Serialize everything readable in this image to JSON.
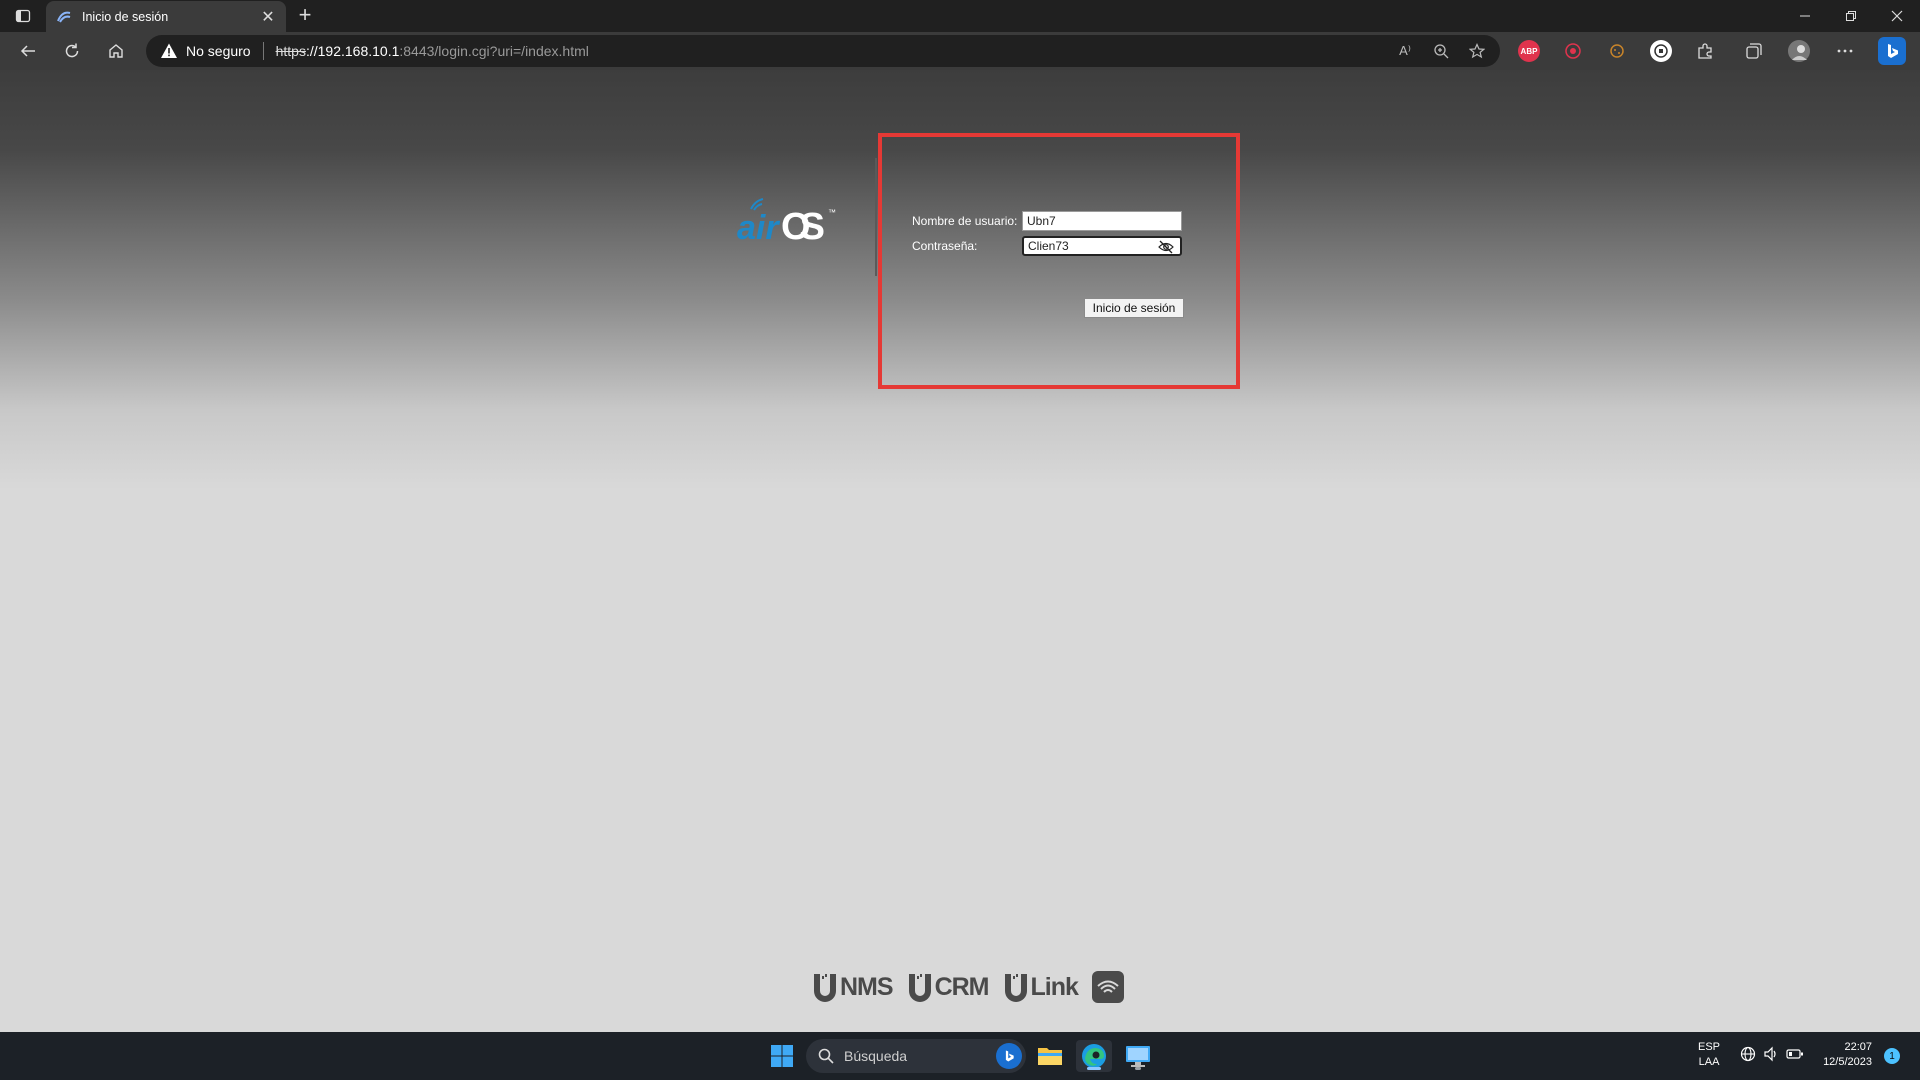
{
  "browser": {
    "tab_title": "Inicio de sesión",
    "tab_close": "✕",
    "new_tab": "+",
    "security_label": "No seguro",
    "url_scheme": "https",
    "url_host": "://192.168.10.1",
    "url_path": ":8443/login.cgi?uri=/index.html",
    "extensions": {
      "abp_label": "ABP",
      "read_aloud_label": "A⁾"
    }
  },
  "login": {
    "logo_text": "airOS",
    "logo_tm": "™",
    "username_label": "Nombre de usuario:",
    "username_value": "Ubn7",
    "password_label": "Contraseña:",
    "password_value": "Clien73",
    "submit_label": "Inicio de sesión"
  },
  "footer": {
    "products": [
      "NMS",
      "CRM",
      "Link"
    ]
  },
  "taskbar": {
    "search_placeholder": "Búsqueda",
    "language_line1": "ESP",
    "language_line2": "LAA",
    "time": "22:07",
    "date": "12/5/2023",
    "notification_count": "1"
  },
  "colors": {
    "highlight_border": "#e53935",
    "air_blue": "#1e88c8",
    "page_dark": "#3d3d3d",
    "page_light": "#d9d9d9"
  }
}
